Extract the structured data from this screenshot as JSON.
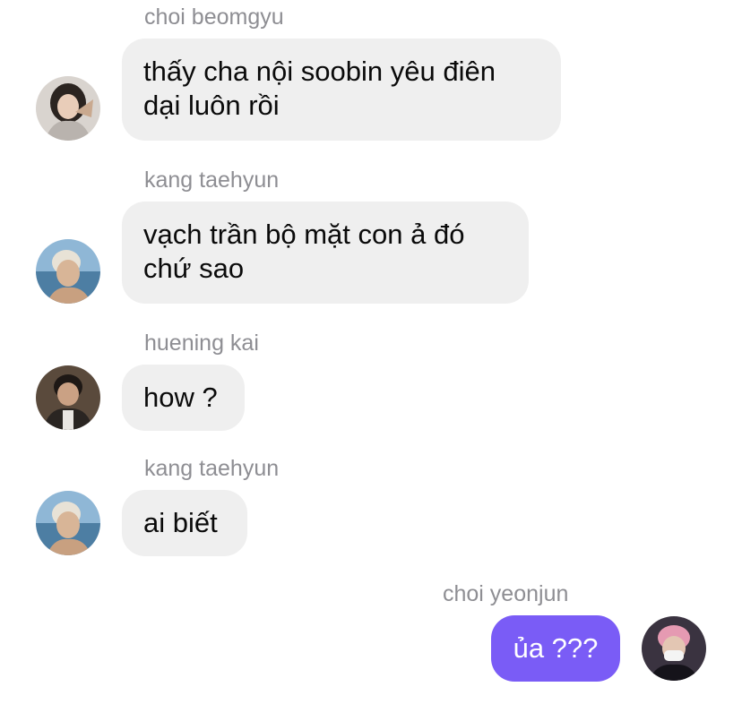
{
  "colors": {
    "incoming_bubble": "#efefef",
    "outgoing_bubble": "#7a5cf6",
    "sender_name": "#8e8e93",
    "text": "#0a0a0a"
  },
  "messages": [
    {
      "sender": "choi beomgyu",
      "direction": "incoming",
      "avatar_icon": "avatar-beomgyu-icon",
      "lines": [
        "thấy cha nội soobin yêu điên",
        "dại luôn rồi"
      ]
    },
    {
      "sender": "kang taehyun",
      "direction": "incoming",
      "avatar_icon": "avatar-taehyun-icon",
      "lines": [
        "vạch trần bộ mặt con ả đó",
        "chứ sao"
      ]
    },
    {
      "sender": "huening kai",
      "direction": "incoming",
      "avatar_icon": "avatar-hueningkai-icon",
      "lines": [
        "how ?"
      ]
    },
    {
      "sender": "kang taehyun",
      "direction": "incoming",
      "avatar_icon": "avatar-taehyun-icon",
      "lines": [
        "ai biết"
      ]
    },
    {
      "sender": "choi yeonjun",
      "direction": "outgoing",
      "avatar_icon": "avatar-yeonjun-icon",
      "lines": [
        "ủa ???"
      ]
    }
  ]
}
